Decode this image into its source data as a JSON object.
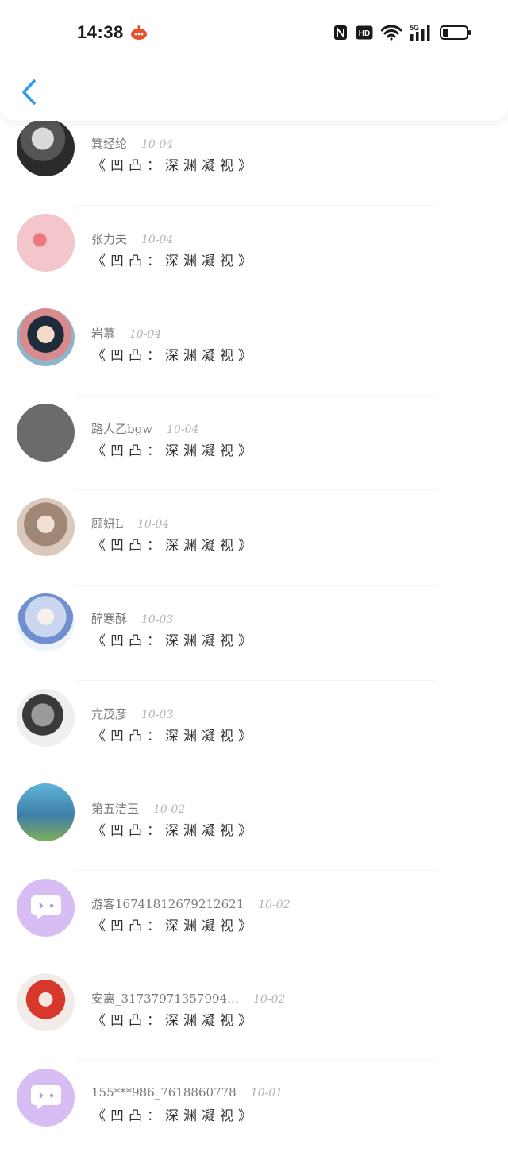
{
  "status": {
    "time": "14:38",
    "icons": [
      "nfc-icon",
      "hd-icon",
      "wifi-icon",
      "5g-signal-icon",
      "battery-icon"
    ],
    "hd": "HD",
    "net": "5G"
  },
  "nav": {
    "back_icon": "chevron-left-icon"
  },
  "list": {
    "items": [
      {
        "name": "箕经纶",
        "date": "10-04",
        "title": "《凹凸：深渊凝视》",
        "avatar_color": "#5a5f62"
      },
      {
        "name": "张力夫",
        "date": "10-04",
        "title": "《凹凸：深渊凝视》",
        "avatar_color": "#f3c6cb"
      },
      {
        "name": "岩慕",
        "date": "10-04",
        "title": "《凹凸：深渊凝视》",
        "avatar_color": "#d98a8c"
      },
      {
        "name": "路人乙bgw",
        "date": "10-04",
        "title": "《凹凸：深渊凝视》",
        "avatar_color": "#6b6b6e"
      },
      {
        "name": "顾妍L",
        "date": "10-04",
        "title": "《凹凸：深渊凝视》",
        "avatar_color": "#b9a697"
      },
      {
        "name": "醉寒酥",
        "date": "10-03",
        "title": "《凹凸：深渊凝视》",
        "avatar_color": "#c9d6ee"
      },
      {
        "name": "亢茂彦",
        "date": "10-03",
        "title": "《凹凸：深渊凝视》",
        "avatar_color": "#8c8c8c"
      },
      {
        "name": "第五洁玉",
        "date": "10-02",
        "title": "《凹凸：深渊凝视》",
        "avatar_color": "#4f8fb0"
      },
      {
        "name": "游客16741812679212621",
        "date": "10-02",
        "title": "《凹凸：深渊凝视》",
        "avatar_color": "#d7bdf3"
      },
      {
        "name": "安离_31737971357994…",
        "date": "10-02",
        "title": "《凹凸：深渊凝视》",
        "avatar_color": "#e8d7d2"
      },
      {
        "name": "155***986_7618860778",
        "date": "10-01",
        "title": "《凹凸：深渊凝视》",
        "avatar_color": "#d7bdf3"
      }
    ]
  },
  "colors": {
    "accent": "#2b9af3",
    "divider": "#f3f3f3"
  }
}
